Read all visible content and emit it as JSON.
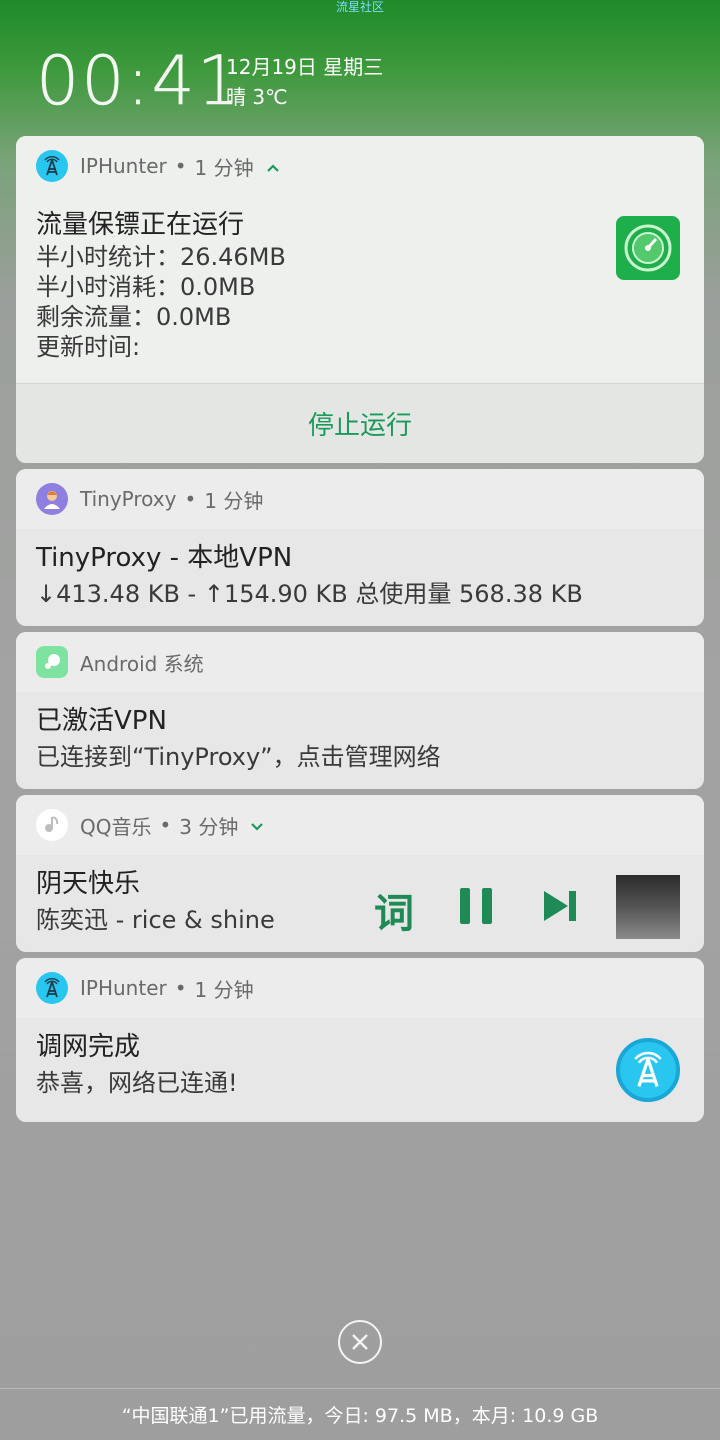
{
  "top_label": "流星社区",
  "lockscreen": {
    "time": "00:41",
    "date": "12月19日 星期三",
    "weather": "晴 3℃"
  },
  "notifications": [
    {
      "app": "IPHunter",
      "time": "1 分钟",
      "title": "流量保镖正在运行",
      "lines": [
        "半小时统计：26.46MB",
        "半小时消耗：0.0MB",
        "剩余流量：0.0MB",
        "更新时间:"
      ],
      "action": "停止运行",
      "icon": "antenna-icon"
    },
    {
      "app": "TinyProxy",
      "time": "1 分钟",
      "title": "TinyProxy - 本地VPN",
      "text": "↓413.48 KB - ↑154.90 KB 总使用量 568.38 KB",
      "icon": "avatar-icon"
    },
    {
      "app": "Android 系统",
      "title": "已激活VPN",
      "text": "已连接到“TinyProxy”，点击管理网络",
      "icon": "android-system-icon"
    },
    {
      "app": "QQ音乐",
      "time": "3 分钟",
      "title": "阴天快乐",
      "text": "陈奕迅 - rice & shine",
      "lyric_button": "词",
      "icon": "qq-music-icon"
    },
    {
      "app": "IPHunter",
      "time": "1 分钟",
      "title": "调网完成",
      "text": "恭喜，网络已连通!",
      "icon": "antenna-icon"
    }
  ],
  "footer": "“中国联通1”已用流量，今日: 97.5 MB，本月: 10.9 GB",
  "colors": {
    "accent_green": "#1a9a5c",
    "iphunter_blue": "#29c6f0"
  }
}
